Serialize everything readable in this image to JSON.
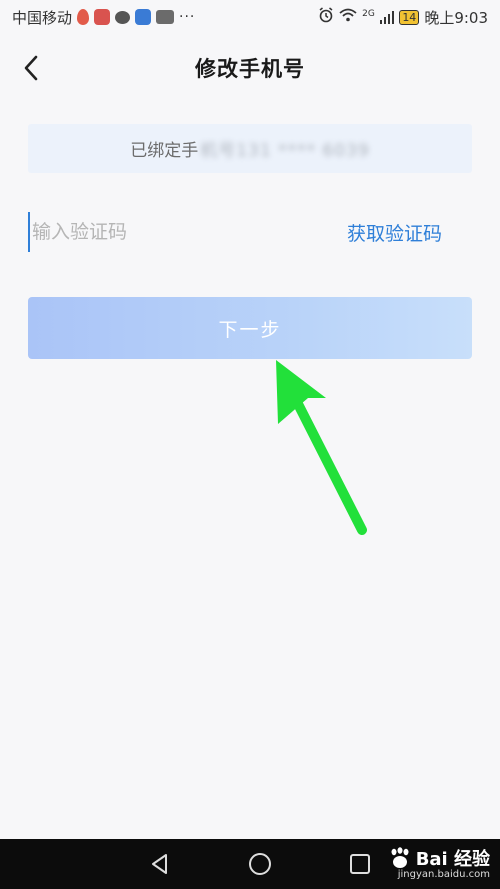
{
  "status_bar": {
    "carrier": "中国移动",
    "more": "···",
    "network": "2G",
    "battery": "14",
    "time": "晚上9:03"
  },
  "header": {
    "title": "修改手机号"
  },
  "bound": {
    "prefix": "已绑定手",
    "masked": "机号131 **** 6039"
  },
  "code": {
    "placeholder": "输入验证码",
    "get_code_label": "获取验证码"
  },
  "next_button": {
    "label": "下一步"
  },
  "watermark": {
    "brand": "Bai 经验",
    "site": "jingyan.baidu.com"
  },
  "colors": {
    "accent": "#2f7fd8",
    "button_gradient_start": "#aac4f7",
    "button_gradient_end": "#c8dffa",
    "arrow": "#22e03a"
  }
}
